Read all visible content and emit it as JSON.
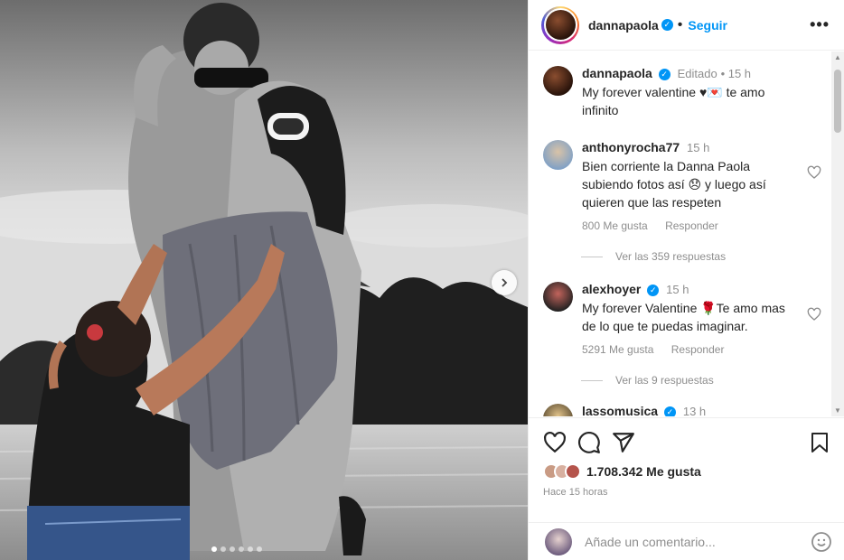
{
  "header": {
    "username": "dannapaola",
    "verified_icon": "verified-badge-icon",
    "follow_label": "Seguir",
    "more_icon": "more-options-icon"
  },
  "media": {
    "next_icon": "chevron-right-icon",
    "carousel_pages": 6,
    "carousel_active": 1
  },
  "caption": {
    "username": "dannapaola",
    "edited": "Editado",
    "time": "15 h",
    "text_line1": "My forever valentine ♥💌 te amo",
    "text_line2": "infinito"
  },
  "comments": [
    {
      "username": "anthonyrocha77",
      "time": "15 h",
      "lines": [
        "Bien corriente la Danna Paola",
        "subiendo fotos así 😞 y luego así",
        "quieren que las respeten"
      ],
      "likes": "800 Me gusta",
      "reply": "Responder",
      "view_replies": "Ver las 359 respuestas"
    },
    {
      "username": "alexhoyer",
      "verified": true,
      "time": "15 h",
      "lines": [
        "My forever Valentine 🌹Te amo mas",
        "de lo que te puedas imaginar."
      ],
      "likes": "5291 Me gusta",
      "reply": "Responder",
      "view_replies": "Ver las 9 respuestas"
    },
    {
      "username": "lassomusica",
      "verified": true,
      "time": "13 h"
    }
  ],
  "actions": {
    "like_icon": "heart-icon",
    "comment_icon": "comment-icon",
    "share_icon": "share-icon",
    "save_icon": "bookmark-icon",
    "likes_count": "1.708.342 Me gusta",
    "time_ago": "Hace 15 horas"
  },
  "add_comment": {
    "placeholder": "Añade un comentario...",
    "emoji_icon": "emoji-icon"
  },
  "colors": {
    "accent": "#0095f6",
    "secondary_text": "#8e8e8e",
    "text": "#262626"
  }
}
